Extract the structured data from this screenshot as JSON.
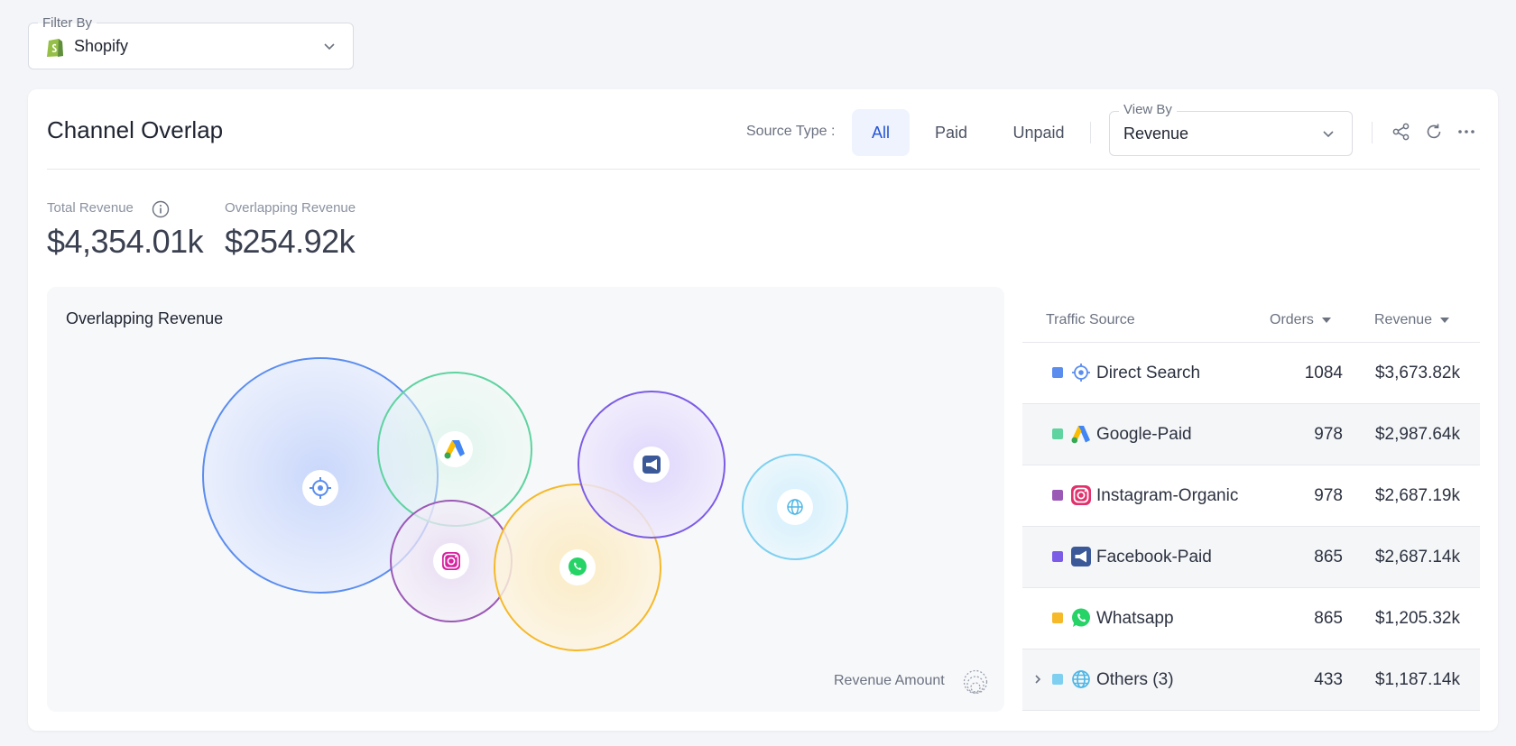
{
  "filter": {
    "legend": "Filter By",
    "value": "Shopify",
    "icon": "shopify-icon"
  },
  "card": {
    "title": "Channel Overlap",
    "source_type_label": "Source Type :",
    "source_types": [
      {
        "label": "All",
        "active": true
      },
      {
        "label": "Paid",
        "active": false
      },
      {
        "label": "Unpaid",
        "active": false
      }
    ],
    "view_by": {
      "legend": "View By",
      "value": "Revenue"
    },
    "tools": [
      "share-icon",
      "refresh-icon",
      "more-icon"
    ]
  },
  "kpis": {
    "total_revenue_label": "Total Revenue",
    "total_revenue_value": "$4,354.01k",
    "overlapping_revenue_label": "Overlapping Revenue",
    "overlapping_revenue_value": "$254.92k"
  },
  "chart": {
    "title": "Overlapping Revenue",
    "legend_label": "Revenue Amount"
  },
  "chart_data": {
    "type": "bubble-overlap",
    "series": [
      {
        "name": "Direct Search",
        "color": "#5b8def",
        "icon": "target-icon"
      },
      {
        "name": "Google-Paid",
        "color": "#5fd3a0",
        "icon": "google-ads-icon"
      },
      {
        "name": "Instagram-Organic",
        "color": "#9b59b6",
        "icon": "instagram-icon"
      },
      {
        "name": "Whatsapp",
        "color": "#f5b92a",
        "icon": "whatsapp-icon"
      },
      {
        "name": "Facebook-Paid",
        "color": "#7b5ce6",
        "icon": "facebook-ads-icon"
      },
      {
        "name": "Others (3)",
        "color": "#7fd0f0",
        "icon": "globe-icon"
      }
    ]
  },
  "table": {
    "headers": {
      "source": "Traffic Source",
      "orders": "Orders",
      "revenue": "Revenue"
    },
    "rows": [
      {
        "name": "Direct Search",
        "orders": "1084",
        "revenue": "$3,673.82k",
        "color": "#5b8def",
        "icon": "target-icon"
      },
      {
        "name": "Google-Paid",
        "orders": "978",
        "revenue": "$2,987.64k",
        "color": "#5fd3a0",
        "icon": "google-ads-icon"
      },
      {
        "name": "Instagram-Organic",
        "orders": "978",
        "revenue": "$2,687.19k",
        "color": "#9b59b6",
        "icon": "instagram-icon"
      },
      {
        "name": "Facebook-Paid",
        "orders": "865",
        "revenue": "$2,687.14k",
        "color": "#7b5ce6",
        "icon": "facebook-ads-icon"
      },
      {
        "name": "Whatsapp",
        "orders": "865",
        "revenue": "$1,205.32k",
        "color": "#f5b92a",
        "icon": "whatsapp-icon"
      },
      {
        "name": "Others (3)",
        "orders": "433",
        "revenue": "$1,187.14k",
        "color": "#7fd0f0",
        "icon": "globe-icon",
        "expandable": true
      }
    ]
  }
}
